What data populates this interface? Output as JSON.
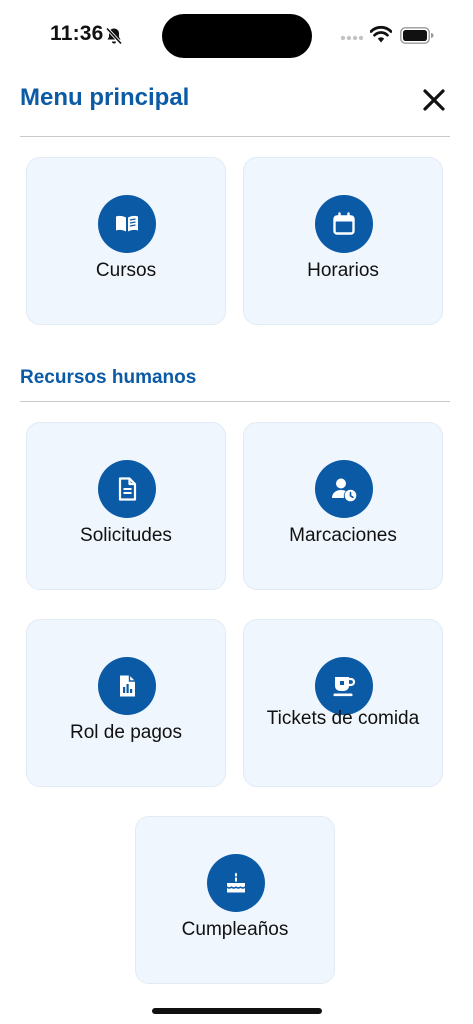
{
  "status_bar": {
    "time": "11:36",
    "icons": [
      "bell-slash-icon",
      "signal-icon",
      "wifi-icon",
      "battery-icon"
    ]
  },
  "header": {
    "title": "Menu principal",
    "close_icon": "close-icon"
  },
  "main_menu": {
    "items": [
      {
        "label": "Cursos",
        "icon": "book-open-icon"
      },
      {
        "label": "Horarios",
        "icon": "calendar-icon"
      }
    ]
  },
  "rrhh": {
    "title": "Recursos humanos",
    "items": [
      {
        "label": "Solicitudes",
        "icon": "document-icon"
      },
      {
        "label": "Marcaciones",
        "icon": "user-clock-icon"
      },
      {
        "label": "Rol de pagos",
        "icon": "report-chart-icon"
      },
      {
        "label": "Tickets de comida",
        "icon": "coffee-cup-icon"
      },
      {
        "label": "Cumpleaños",
        "icon": "birthday-cake-icon"
      }
    ]
  },
  "colors": {
    "accent": "#0b5aa6",
    "card_bg": "#eff6fd",
    "text": "#111111",
    "divider": "#c9c9c9"
  }
}
